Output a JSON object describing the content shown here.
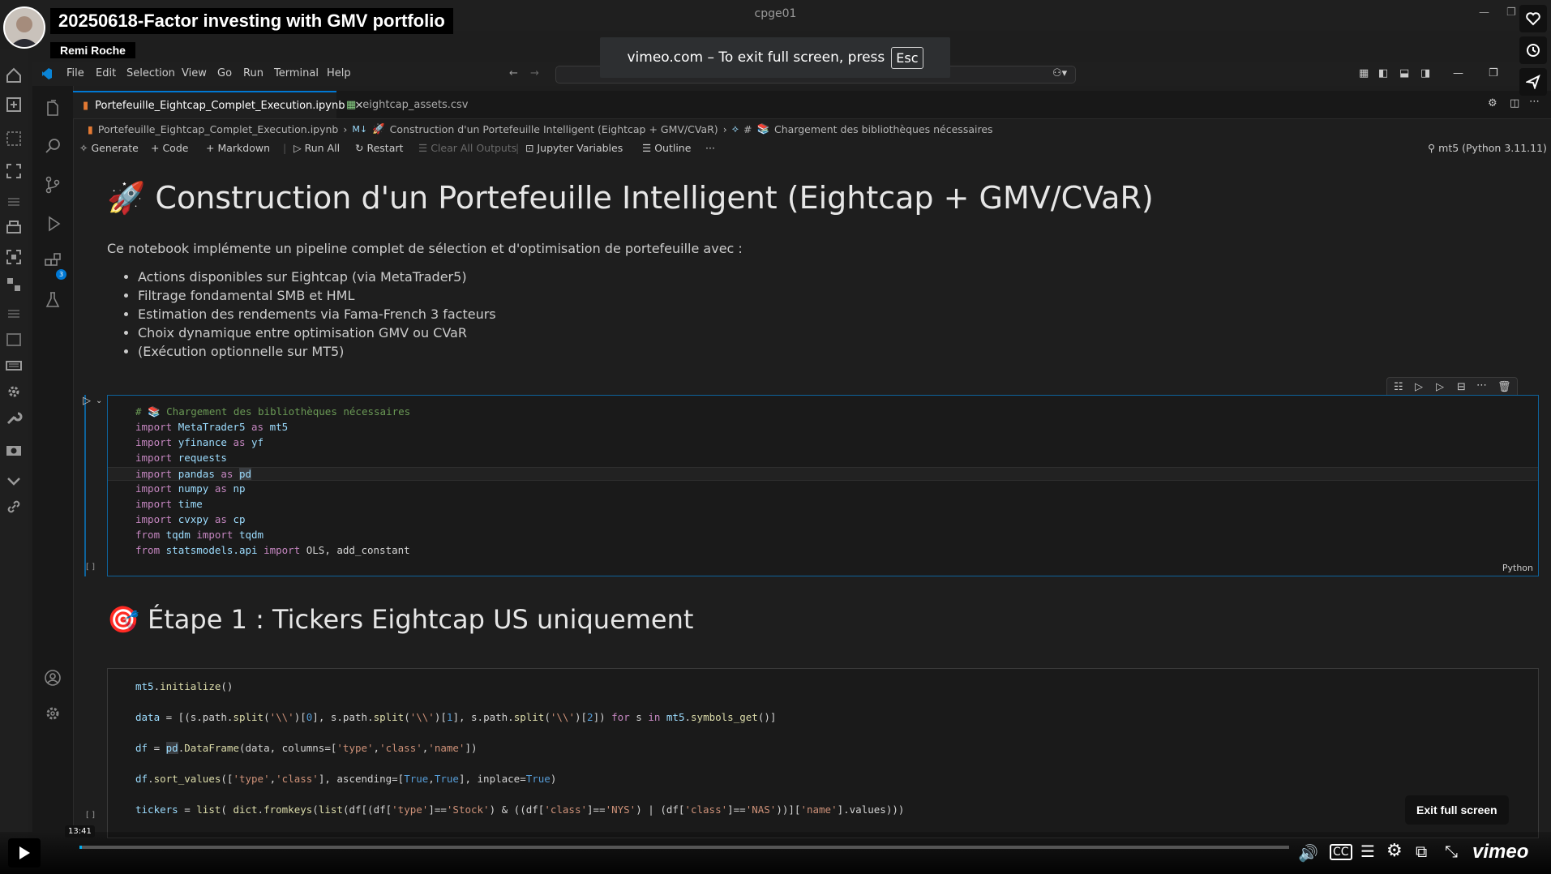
{
  "window": {
    "title": "cpge01"
  },
  "video": {
    "title": "20250618-Factor investing with GMV portfolio",
    "author": "Remi Roche",
    "fullscreen_notice": "vimeo.com – To exit full screen, press",
    "esc_key": "Esc",
    "exit_fullscreen_label": "Exit full screen",
    "time": "13:41",
    "brand": "vimeo",
    "progress_fraction": 0.002
  },
  "menu": [
    "File",
    "Edit",
    "Selection",
    "View",
    "Go",
    "Run",
    "Terminal",
    "Help"
  ],
  "tabs": [
    {
      "label": "Portefeuille_Eightcap_Complet_Execution.ipynb",
      "active": true
    },
    {
      "label": "eightcap_assets.csv",
      "active": false
    }
  ],
  "breadcrumb": {
    "file": "Portefeuille_Eightcap_Complet_Execution.ipynb",
    "md_badge": "M↓",
    "section": "Construction d'un Portefeuille Intelligent (Eightcap + GMV/CVaR)",
    "cell": "Chargement des bibliothèques nécessaires"
  },
  "toolbar": {
    "generate": "Generate",
    "code": "Code",
    "markdown": "Markdown",
    "run_all": "Run All",
    "restart": "Restart",
    "clear_outputs": "Clear All Outputs",
    "variables": "Jupyter Variables",
    "outline": "Outline",
    "more": "···",
    "kernel": "mt5 (Python 3.11.11)"
  },
  "notebook": {
    "h1": "Construction d'un Portefeuille Intelligent (Eightcap + GMV/CVaR)",
    "intro": "Ce notebook implémente un pipeline complet de sélection et d'optimisation de portefeuille avec :",
    "bullets": [
      "Actions disponibles sur Eightcap (via MetaTrader5)",
      "Filtrage fondamental SMB et HML",
      "Estimation des rendements via Fama-French 3 facteurs",
      "Choix dynamique entre optimisation GMV ou CVaR",
      "(Exécution optionnelle sur MT5)"
    ],
    "cell1_lang": "Python",
    "cell1_exec": "[ ]",
    "cell1_comment": "# 📚 Chargement des bibliothèques nécessaires",
    "h2": "Étape 1 : Tickers Eightcap US uniquement",
    "cell2_exec": "[ ]"
  },
  "colors": {
    "accent": "#0078d4",
    "vimeo": "#00adef"
  }
}
